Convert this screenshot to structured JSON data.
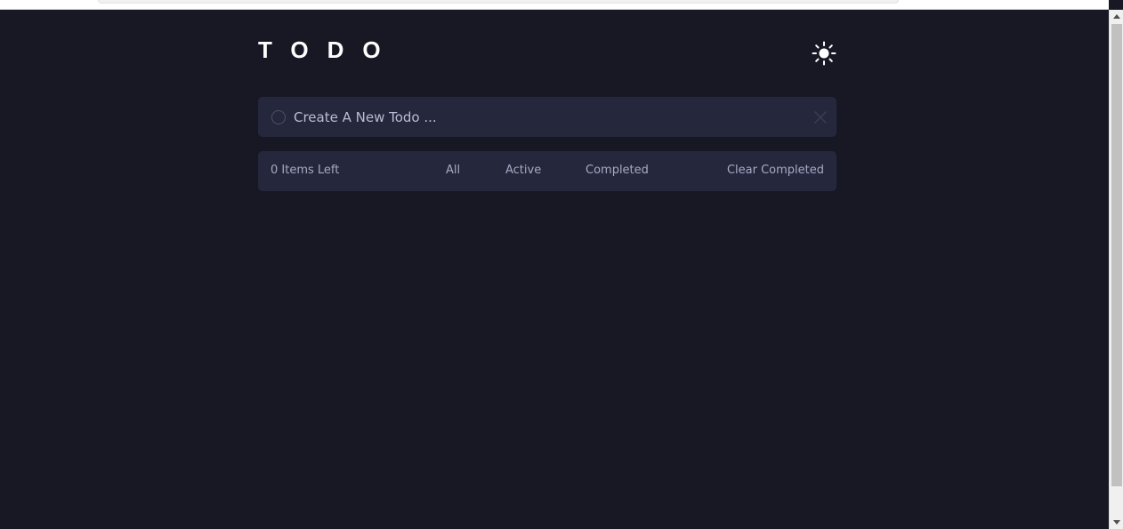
{
  "header": {
    "title": "TODO",
    "theme_toggle_icon": "sun-icon"
  },
  "new_todo": {
    "placeholder": "Create A New Todo ...",
    "value": "",
    "check_icon": "circle-icon",
    "clear_icon": "close-icon"
  },
  "footer": {
    "items_left": "0 Items Left",
    "filters": [
      "All",
      "Active",
      "Completed"
    ],
    "clear_completed": "Clear Completed"
  },
  "colors": {
    "background": "#181824",
    "panel": "#25273c",
    "text": "#a8aac6",
    "title": "#ffffff"
  }
}
